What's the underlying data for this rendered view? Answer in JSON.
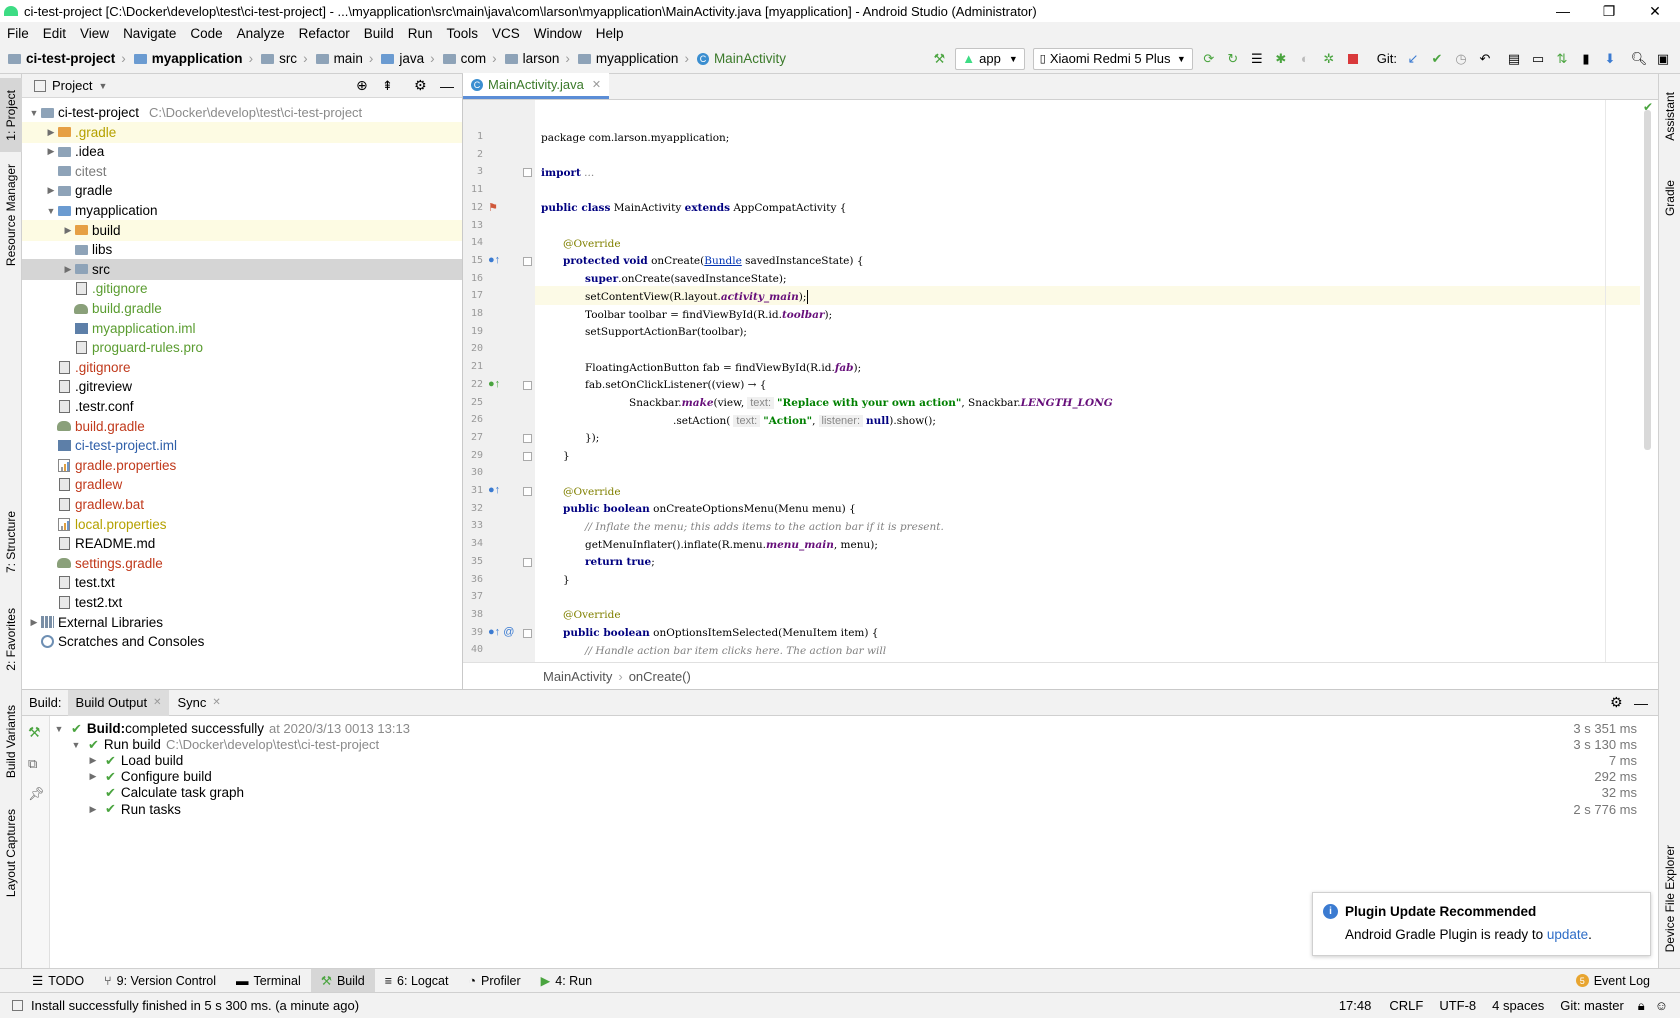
{
  "window": {
    "title": "ci-test-project [C:\\Docker\\develop\\test\\ci-test-project] - ...\\myapplication\\src\\main\\java\\com\\larson\\myapplication\\MainActivity.java [myapplication] - Android Studio (Administrator)"
  },
  "menu": [
    "File",
    "Edit",
    "View",
    "Navigate",
    "Code",
    "Analyze",
    "Refactor",
    "Build",
    "Run",
    "Tools",
    "VCS",
    "Window",
    "Help"
  ],
  "breadcrumbs": [
    "ci-test-project",
    "myapplication",
    "src",
    "main",
    "java",
    "com",
    "larson",
    "myapplication",
    "MainActivity"
  ],
  "toolbar": {
    "run_config": "app",
    "device": "Xiaomi Redmi 5 Plus",
    "git_label": "Git:"
  },
  "left_tabs": [
    "1: Project",
    "Resource Manager",
    "7: Structure",
    "2: Favorites",
    "Build Variants",
    "Layout Captures"
  ],
  "right_tabs": [
    "Assistant",
    "Gradle",
    "Device File Explorer"
  ],
  "project_panel": {
    "title": "Project",
    "tree": [
      {
        "label": "ci-test-project",
        "path": "C:\\Docker\\develop\\test\\ci-test-project",
        "indent": 0,
        "arrow": "down",
        "icon": "folder"
      },
      {
        "label": ".gradle",
        "indent": 1,
        "arrow": "right",
        "icon": "folder-orange",
        "color": "#b5a100"
      },
      {
        "label": ".idea",
        "indent": 1,
        "arrow": "right",
        "icon": "folder"
      },
      {
        "label": "citest",
        "indent": 1,
        "arrow": "",
        "icon": "folder",
        "color": "#7a7a7a"
      },
      {
        "label": "gradle",
        "indent": 1,
        "arrow": "right",
        "icon": "folder"
      },
      {
        "label": "myapplication",
        "indent": 1,
        "arrow": "down",
        "icon": "folder-blue"
      },
      {
        "label": "build",
        "indent": 2,
        "arrow": "right",
        "icon": "folder-orange"
      },
      {
        "label": "libs",
        "indent": 2,
        "arrow": "",
        "icon": "folder"
      },
      {
        "label": "src",
        "indent": 2,
        "arrow": "right",
        "icon": "folder"
      },
      {
        "label": ".gitignore",
        "indent": 2,
        "arrow": "",
        "icon": "file",
        "color": "#5a9c30"
      },
      {
        "label": "build.gradle",
        "indent": 2,
        "arrow": "",
        "icon": "gradle",
        "color": "#5a9c30"
      },
      {
        "label": "myapplication.iml",
        "indent": 2,
        "arrow": "",
        "icon": "iml",
        "color": "#5a9c30"
      },
      {
        "label": "proguard-rules.pro",
        "indent": 2,
        "arrow": "",
        "icon": "file",
        "color": "#5a9c30"
      },
      {
        "label": ".gitignore",
        "indent": 1,
        "arrow": "",
        "icon": "file",
        "color": "#c0391b"
      },
      {
        "label": ".gitreview",
        "indent": 1,
        "arrow": "",
        "icon": "file"
      },
      {
        "label": ".testr.conf",
        "indent": 1,
        "arrow": "",
        "icon": "file"
      },
      {
        "label": "build.gradle",
        "indent": 1,
        "arrow": "",
        "icon": "gradle",
        "color": "#c0391b"
      },
      {
        "label": "ci-test-project.iml",
        "indent": 1,
        "arrow": "",
        "icon": "iml",
        "color": "#2e5ea8"
      },
      {
        "label": "gradle.properties",
        "indent": 1,
        "arrow": "",
        "icon": "prop",
        "color": "#c0391b"
      },
      {
        "label": "gradlew",
        "indent": 1,
        "arrow": "",
        "icon": "file",
        "color": "#c0391b"
      },
      {
        "label": "gradlew.bat",
        "indent": 1,
        "arrow": "",
        "icon": "file",
        "color": "#c0391b"
      },
      {
        "label": "local.properties",
        "indent": 1,
        "arrow": "",
        "icon": "prop",
        "color": "#b5a100"
      },
      {
        "label": "README.md",
        "indent": 1,
        "arrow": "",
        "icon": "file"
      },
      {
        "label": "settings.gradle",
        "indent": 1,
        "arrow": "",
        "icon": "gradle",
        "color": "#c0391b"
      },
      {
        "label": "test.txt",
        "indent": 1,
        "arrow": "",
        "icon": "file"
      },
      {
        "label": "test2.txt",
        "indent": 1,
        "arrow": "",
        "icon": "file"
      },
      {
        "label": "External Libraries",
        "indent": 0,
        "arrow": "right",
        "icon": "lib"
      },
      {
        "label": "Scratches and Consoles",
        "indent": 0,
        "arrow": "",
        "icon": "scratch"
      }
    ]
  },
  "editor": {
    "tab_label": "MainActivity.java",
    "line_numbers": [
      "1",
      "2",
      "3",
      "11",
      "12",
      "13",
      "14",
      "15",
      "16",
      "17",
      "18",
      "19",
      "20",
      "21",
      "22",
      "25",
      "26",
      "27",
      "29",
      "30",
      "31",
      "32",
      "33",
      "34",
      "35",
      "36",
      "37",
      "38",
      "39",
      "40"
    ],
    "crumbs": [
      "MainActivity",
      "onCreate()"
    ],
    "code": {
      "l1a": "package com.larson.myapplication;",
      "l3a": "import",
      "l3b": " ...",
      "l12a": "public class",
      "l12b": " MainActivity ",
      "l12c": "extends",
      "l12d": " AppCompatActivity {",
      "l14a": "@Override",
      "l15a": "protected void",
      "l15b": " onCreate(",
      "l15c": "Bundle",
      "l15d": " savedInstanceState) {",
      "l16a": "super",
      ".l16b": "",
      "l16c": ".onCreate(savedInstanceState);",
      "l17a": "setContentView(R.layout.",
      "l17b": "activity_main",
      "l17c": ");",
      "l18a": "Toolbar toolbar = findViewById(R.id.",
      "l18b": "toolbar",
      "l18c": ");",
      "l19a": "setSupportActionBar(toolbar);",
      "l21a": "FloatingActionButton fab = findViewById(R.id.",
      "l21b": "fab",
      "l21c": ");",
      "l22a": "fab.setOnClickListener((view) → {",
      "l25a": "Snackbar.",
      "l25b": "make",
      "l25c": "(view,",
      "l25h": "text:",
      "l25d": "\"Replace with your own action\"",
      "l25e": ", Snackbar.",
      "l25f": "LENGTH_LONG",
      ")": "",
      "l26a": ".setAction(",
      "l26h1": "text:",
      "l26b": "\"Action\"",
      "l26c": ",",
      "l26h2": "listener:",
      "l26d": "null",
      "l26e": ").show();",
      "l27a": "});",
      "l29a": "}",
      "l31a": "@Override",
      "l32a": "public boolean",
      "l32b": " onCreateOptionsMenu(Menu menu) {",
      "l33a": "// Inflate the menu; this adds items to the action bar if it is present.",
      "l34a": "getMenuInflater().inflate(R.menu.",
      "l34b": "menu_main",
      "l34c": ", menu);",
      "l35a": "return true",
      "l35b": ";",
      "l36a": "}",
      "l38a": "@Override",
      "l39a": "public boolean",
      "l39b": " onOptionsItemSelected(MenuItem item) {",
      "l40a": "// Handle action bar item clicks here. The action bar will"
    }
  },
  "build_panel": {
    "label": "Build:",
    "tabs": [
      "Build Output",
      "Sync"
    ],
    "rows": [
      {
        "bold": "Build:",
        "text": " completed successfully",
        "extra": "at 2020/3/13 0013 13:13",
        "time": "3 s 351 ms"
      },
      {
        "bold": "",
        "text": "Run build",
        "extra": "C:\\Docker\\develop\\test\\ci-test-project",
        "time": "3 s 130 ms"
      },
      {
        "bold": "",
        "text": "Load build",
        "extra": "",
        "time": "7 ms"
      },
      {
        "bold": "",
        "text": "Configure build",
        "extra": "",
        "time": "292 ms"
      },
      {
        "bold": "",
        "text": "Calculate task graph",
        "extra": "",
        "time": "32 ms"
      },
      {
        "bold": "",
        "text": "Run tasks",
        "extra": "",
        "time": "2 s 776 ms"
      }
    ]
  },
  "notification": {
    "title": "Plugin Update Recommended",
    "body": "Android Gradle Plugin is ready to ",
    "link": "update",
    "tail": "."
  },
  "bottom_tools": [
    "TODO",
    "9: Version Control",
    "Terminal",
    "Build",
    "6: Logcat",
    "Profiler",
    "4: Run"
  ],
  "event_log": {
    "count": "5",
    "label": "Event Log"
  },
  "status": {
    "message": "Install successfully finished in 5 s 300 ms. (a minute ago)",
    "position": "17:48",
    "line_sep": "CRLF",
    "encoding": "UTF-8",
    "indent": "4 spaces",
    "git": "Git: master"
  }
}
